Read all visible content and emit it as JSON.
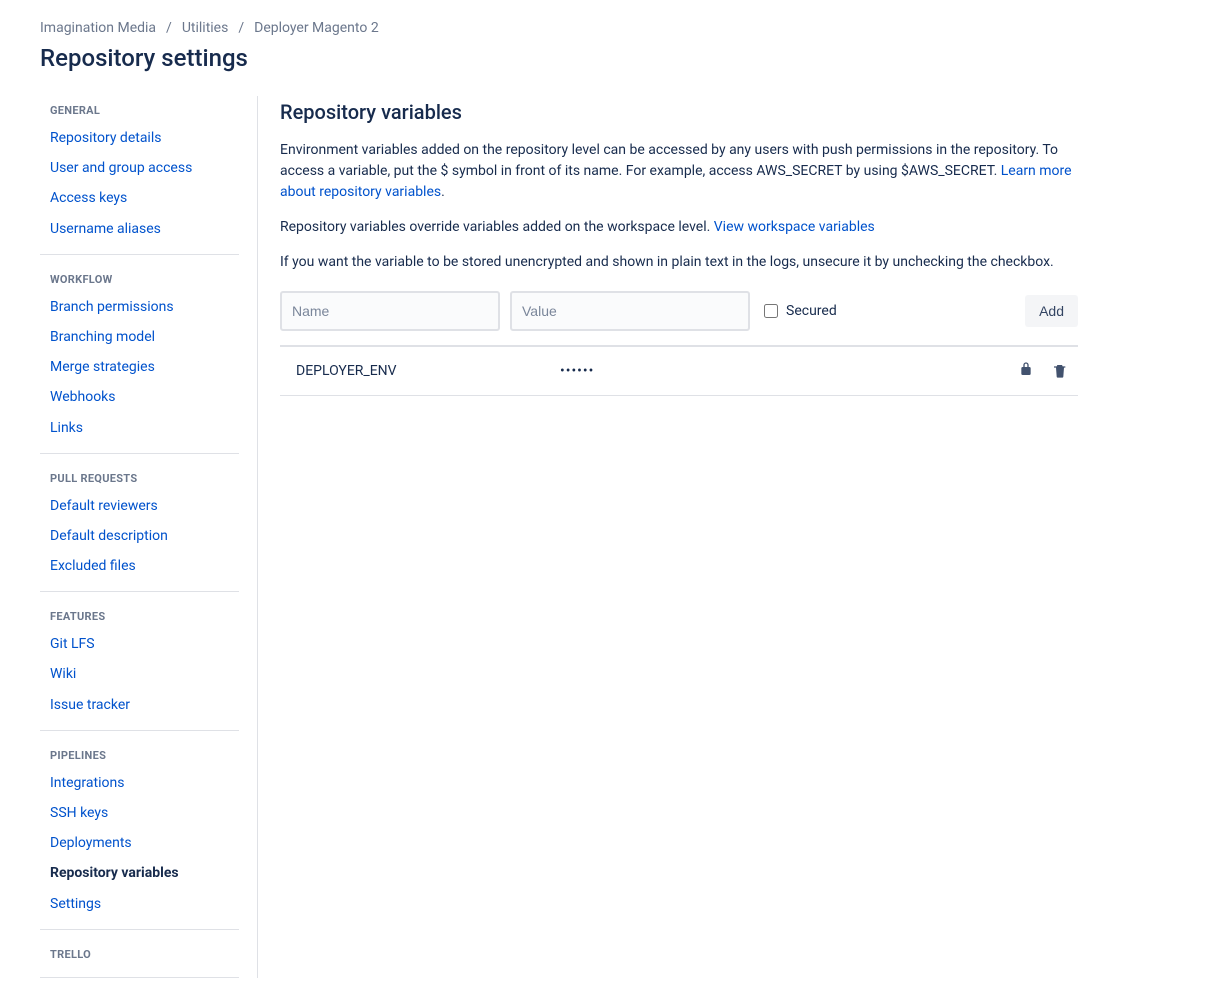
{
  "breadcrumb": {
    "items": [
      "Imagination Media",
      "Utilities",
      "Deployer Magento 2"
    ],
    "sep": "/"
  },
  "pageTitle": "Repository settings",
  "sidebar": {
    "sections": [
      {
        "header": "General",
        "items": [
          {
            "label": "Repository details",
            "active": false
          },
          {
            "label": "User and group access",
            "active": false
          },
          {
            "label": "Access keys",
            "active": false
          },
          {
            "label": "Username aliases",
            "active": false
          }
        ]
      },
      {
        "header": "Workflow",
        "items": [
          {
            "label": "Branch permissions",
            "active": false
          },
          {
            "label": "Branching model",
            "active": false
          },
          {
            "label": "Merge strategies",
            "active": false
          },
          {
            "label": "Webhooks",
            "active": false
          },
          {
            "label": "Links",
            "active": false
          }
        ]
      },
      {
        "header": "Pull Requests",
        "items": [
          {
            "label": "Default reviewers",
            "active": false
          },
          {
            "label": "Default description",
            "active": false
          },
          {
            "label": "Excluded files",
            "active": false
          }
        ]
      },
      {
        "header": "Features",
        "items": [
          {
            "label": "Git LFS",
            "active": false
          },
          {
            "label": "Wiki",
            "active": false
          },
          {
            "label": "Issue tracker",
            "active": false
          }
        ]
      },
      {
        "header": "Pipelines",
        "items": [
          {
            "label": "Integrations",
            "active": false
          },
          {
            "label": "SSH keys",
            "active": false
          },
          {
            "label": "Deployments",
            "active": false
          },
          {
            "label": "Repository variables",
            "active": true
          },
          {
            "label": "Settings",
            "active": false
          }
        ]
      },
      {
        "header": "Trello",
        "items": []
      }
    ]
  },
  "content": {
    "title": "Repository variables",
    "para1a": "Environment variables added on the repository level can be accessed by any users with push permissions in the repository. To access a variable, put the $ symbol in front of its name. For example, access AWS_SECRET by using $AWS_SECRET. ",
    "para1link": "Learn more about repository variables",
    "para1b": ".",
    "para2a": "Repository variables override variables added on the workspace level. ",
    "para2link": "View workspace variables",
    "para3": "If you want the variable to be stored unencrypted and shown in plain text in the logs, unsecure it by unchecking the checkbox.",
    "form": {
      "namePlaceholder": "Name",
      "valuePlaceholder": "Value",
      "securedLabel": "Secured",
      "addLabel": "Add"
    },
    "variables": [
      {
        "name": "DEPLOYER_ENV",
        "value": "••••••",
        "secured": true
      }
    ]
  }
}
